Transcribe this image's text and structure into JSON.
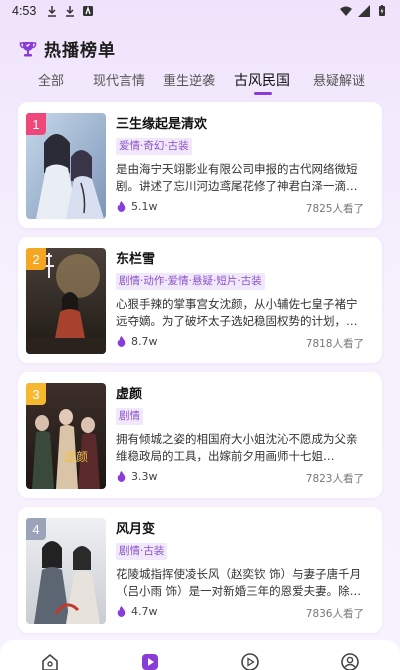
{
  "status_bar": {
    "time": "4:53"
  },
  "header": {
    "title": "热播榜单"
  },
  "tabs": [
    {
      "label": "全部",
      "active": false
    },
    {
      "label": "现代言情",
      "active": false
    },
    {
      "label": "重生逆袭",
      "active": false
    },
    {
      "label": "古风民国",
      "active": true
    },
    {
      "label": "悬疑解谜",
      "active": false
    }
  ],
  "items": [
    {
      "rank": "1",
      "rank_color": "#f0477a",
      "title": "三生缘起是清欢",
      "tags": "爱情·奇幻·古装",
      "desc": "是由海宁天翊影业有限公司申报的古代网络微短剧。讲述了忘川河边鸢尾花修了神君白泽一滴…",
      "likes": "5.1w",
      "views": "7825人看了"
    },
    {
      "rank": "2",
      "rank_color": "#f5a623",
      "title": "东栏雪",
      "tags": "剧情·动作·爱情·悬疑·短片·古装",
      "desc": "心狠手辣的掌事宫女沈颜，从小辅佐七皇子褚宁远夺嫡。为了破坏太子选妃稳固权势的计划，…",
      "likes": "8.7w",
      "views": "7818人看了"
    },
    {
      "rank": "3",
      "rank_color": "#f5b82e",
      "title": "虚颜",
      "tags": "剧情",
      "desc": "拥有倾城之姿的相国府大小姐沈沁不愿成为父亲维稳政局的工具，出嫁前夕用画师十七姐…",
      "likes": "3.3w",
      "views": "7823人看了"
    },
    {
      "rank": "4",
      "rank_color": "#9aa3b8",
      "title": "风月变",
      "tags": "剧情·古装",
      "desc": "花陵城指挥使凌长风（赵奕钦 饰）与妻子唐千月（吕小雨 饰）是一对新婚三年的恩爱夫妻。除…",
      "likes": "4.7w",
      "views": "7836人看了"
    }
  ],
  "colors": {
    "accent": "#8a3cd9",
    "tag_bg": "#f1e8fb",
    "tag_text": "#8b54c7"
  }
}
